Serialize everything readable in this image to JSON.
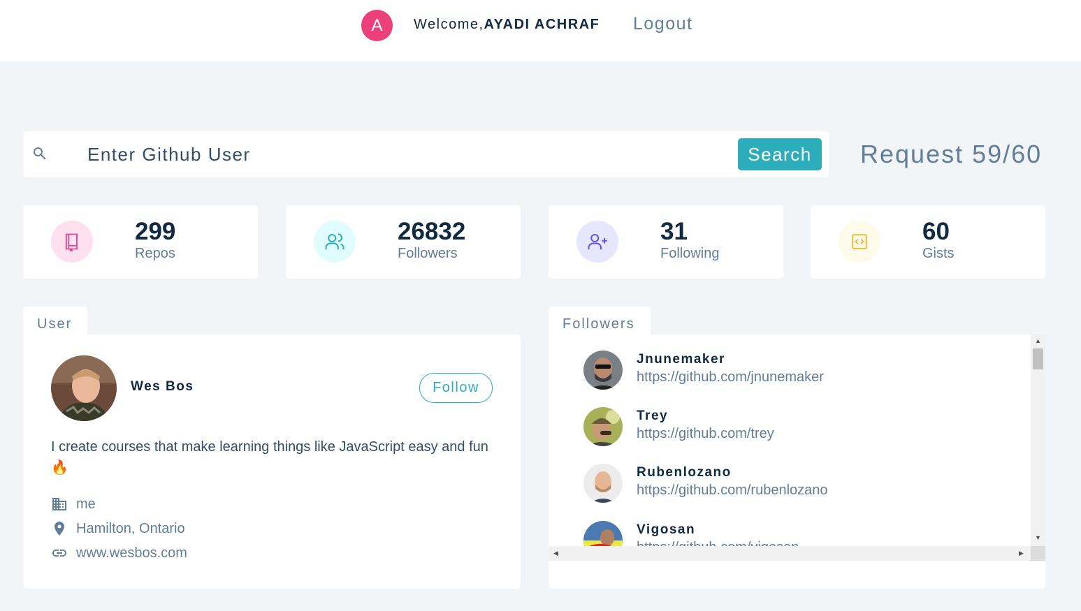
{
  "navbar": {
    "avatar_initial": "A",
    "welcome_prefix": "Welcome,",
    "user_name": "AYADI ACHRAF",
    "logout_label": "Logout"
  },
  "search": {
    "placeholder": "Enter Github User",
    "button_label": "Search",
    "request_text": "Request 59/60"
  },
  "stats": [
    {
      "value": "299",
      "label": "Repos",
      "icon": "book-icon",
      "color": "#da4a91",
      "bg": "#ffe0f0"
    },
    {
      "value": "26832",
      "label": "Followers",
      "icon": "users-icon",
      "color": "#2caeba",
      "bg": "#e0fcff"
    },
    {
      "value": "31",
      "label": "Following",
      "icon": "user-plus-icon",
      "color": "#5d55fa",
      "bg": "#e6e6ff"
    },
    {
      "value": "60",
      "label": "Gists",
      "icon": "code-icon",
      "color": "#f0b429",
      "bg": "#fffbea"
    }
  ],
  "user_card": {
    "tab_label": "User",
    "name": "Wes Bos",
    "follow_label": "Follow",
    "bio": "I create courses that make learning things like JavaScript easy and fun 🔥",
    "company": "me",
    "location": "Hamilton, Ontario",
    "blog": "www.wesbos.com"
  },
  "followers_card": {
    "tab_label": "Followers",
    "items": [
      {
        "name": "Jnunemaker",
        "url": "https://github.com/jnunemaker"
      },
      {
        "name": "Trey",
        "url": "https://github.com/trey"
      },
      {
        "name": "Rubenlozano",
        "url": "https://github.com/rubenlozano"
      },
      {
        "name": "Vigosan",
        "url": "https://github.com/vigosan"
      }
    ]
  }
}
